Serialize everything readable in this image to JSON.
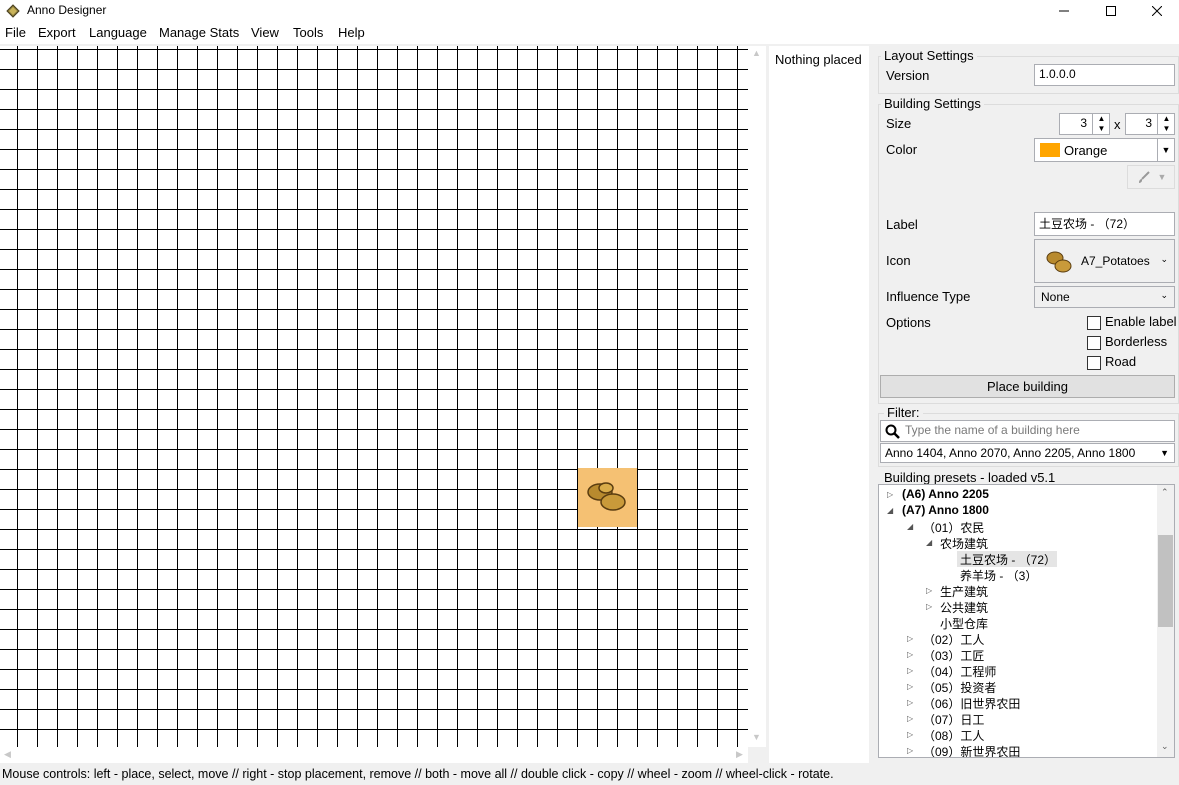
{
  "window": {
    "title": "Anno Designer"
  },
  "menu": [
    {
      "label": "File"
    },
    {
      "label": "Export"
    },
    {
      "label": "Language"
    },
    {
      "label": "Manage Stats"
    },
    {
      "label": "View"
    },
    {
      "label": "Tools"
    },
    {
      "label": "Help"
    }
  ],
  "canvas": {
    "placed_building_icon": "potatoes-icon",
    "placed_building_color": "#f5c173"
  },
  "stats": {
    "text": "Nothing placed"
  },
  "layout_settings": {
    "title": "Layout Settings",
    "version_label": "Version",
    "version_value": "1.0.0.0"
  },
  "building_settings": {
    "title": "Building Settings",
    "size_label": "Size",
    "size_width": "3",
    "size_x": "x",
    "size_height": "3",
    "color_label": "Color",
    "color_name": "Orange",
    "color_swatch": "#ffa500",
    "label_label": "Label",
    "label_value": "土豆农场 - （72）",
    "icon_label": "Icon",
    "icon_value": "A7_Potatoes",
    "influence_label": "Influence Type",
    "influence_value": "None",
    "options_label": "Options",
    "enable_label": "Enable label",
    "borderless": "Borderless",
    "road": "Road",
    "place_button": "Place building"
  },
  "filter": {
    "title": "Filter:",
    "search_placeholder": "Type the name of a building here",
    "games_value": "Anno 1404, Anno 2070, Anno 2205, Anno 1800"
  },
  "presets": {
    "title": "Building presets - loaded v5.1",
    "items": [
      {
        "label": "(A6) Anno 2205"
      },
      {
        "label": "(A7) Anno 1800"
      },
      {
        "label": "（01）农民"
      },
      {
        "label": "农场建筑"
      },
      {
        "label": "土豆农场 - （72）"
      },
      {
        "label": "养羊场 - （3）"
      },
      {
        "label": "生产建筑"
      },
      {
        "label": "公共建筑"
      },
      {
        "label": "小型仓库"
      },
      {
        "label": "（02）工人"
      },
      {
        "label": "（03）工匠"
      },
      {
        "label": "（04）工程师"
      },
      {
        "label": "（05）投资者"
      },
      {
        "label": "（06）旧世界农田"
      },
      {
        "label": "（07）日工"
      },
      {
        "label": "（08）工人"
      },
      {
        "label": "（09）新世界农田"
      }
    ]
  },
  "status": {
    "text": "Mouse controls: left - place, select, move // right - stop placement, remove // both - move all // double click - copy // wheel - zoom // wheel-click - rotate."
  }
}
